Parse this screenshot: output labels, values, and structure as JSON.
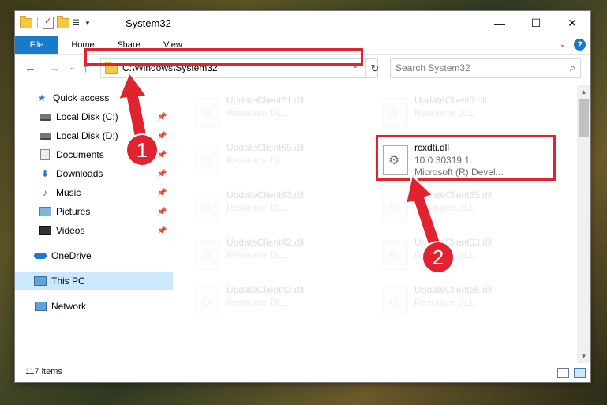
{
  "window": {
    "title": "System32",
    "controls": {
      "minimize": "—",
      "maximize": "☐",
      "close": "✕"
    }
  },
  "ribbon": {
    "tabs": [
      {
        "label": "File"
      },
      {
        "label": "Home"
      },
      {
        "label": "Share"
      },
      {
        "label": "View"
      }
    ]
  },
  "navbar": {
    "address": "C:\\Windows\\System32",
    "search_placeholder": "Search System32"
  },
  "sidebar": {
    "items": [
      {
        "label": "Quick access"
      },
      {
        "label": "Local Disk (C:)"
      },
      {
        "label": "Local Disk (D:)"
      },
      {
        "label": "Documents"
      },
      {
        "label": "Downloads"
      },
      {
        "label": "Music"
      },
      {
        "label": "Pictures"
      },
      {
        "label": "Videos"
      },
      {
        "label": "OneDrive"
      },
      {
        "label": "This PC"
      },
      {
        "label": "Network"
      }
    ]
  },
  "files": [
    {
      "name": "UpdateClient21.dll",
      "type": "Resource DLL"
    },
    {
      "name": "UpdateClient5.dll",
      "type": "Resource DLL"
    },
    {
      "name": "UpdateClient65.dll",
      "type": "Resource DLL"
    },
    {
      "name": "rcxdti.dll",
      "version": "10.0.30319.1",
      "company": "Microsoft (R) Devel..."
    },
    {
      "name": "UpdateClient63.dll",
      "type": "Resource DLL"
    },
    {
      "name": "UpdateClient65.dll",
      "type": "Resource DLL"
    },
    {
      "name": "UpdateClient42.dll",
      "type": "Resource DLL"
    },
    {
      "name": "UpdateClient63.dll",
      "type": "Resource DLL"
    },
    {
      "name": "UpdateClient42.dll",
      "type": "Resource DLL"
    },
    {
      "name": "UpdateClient65.dll",
      "type": "Resource DLL"
    }
  ],
  "status": {
    "item_count": "117 items"
  },
  "annotations": {
    "badge1": "1",
    "badge2": "2",
    "color": "#e0232e"
  }
}
